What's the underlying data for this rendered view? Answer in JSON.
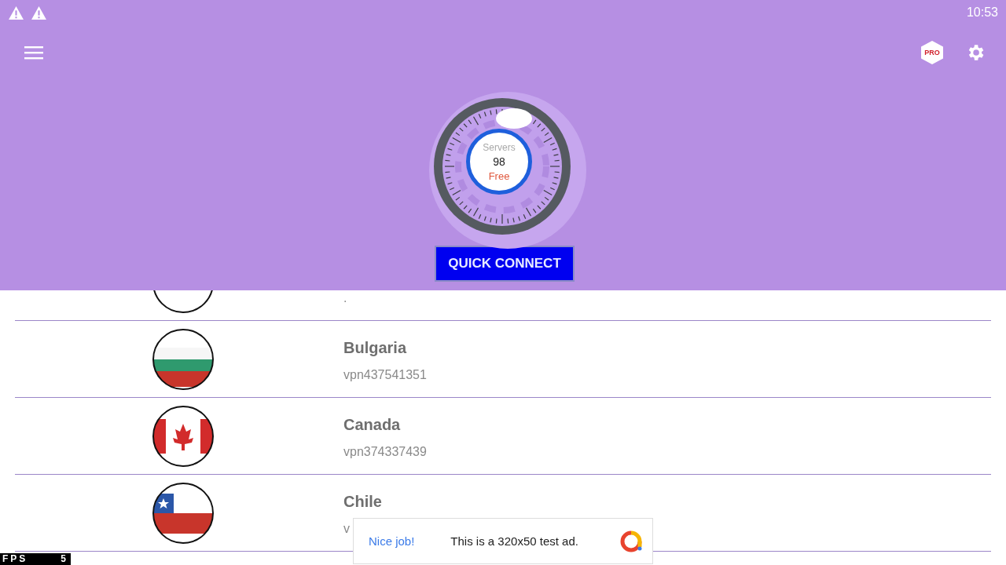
{
  "status_bar": {
    "time": "10:53"
  },
  "pro_badge": "PRO",
  "gauge": {
    "label": "Servers",
    "count": "98",
    "plan": "Free"
  },
  "quick_connect": "QUICK CONNECT",
  "servers": [
    {
      "kind": "unknown",
      "server": "."
    },
    {
      "kind": "bulgaria",
      "country": "Bulgaria",
      "server": "vpn437541351"
    },
    {
      "kind": "canada",
      "country": "Canada",
      "server": "vpn374337439"
    },
    {
      "kind": "chile",
      "country": "Chile",
      "server": "v"
    }
  ],
  "ad": {
    "headline": "Nice job!",
    "text": "This is a 320x50 test ad."
  },
  "fps": {
    "label": "FPS",
    "value": "5"
  }
}
